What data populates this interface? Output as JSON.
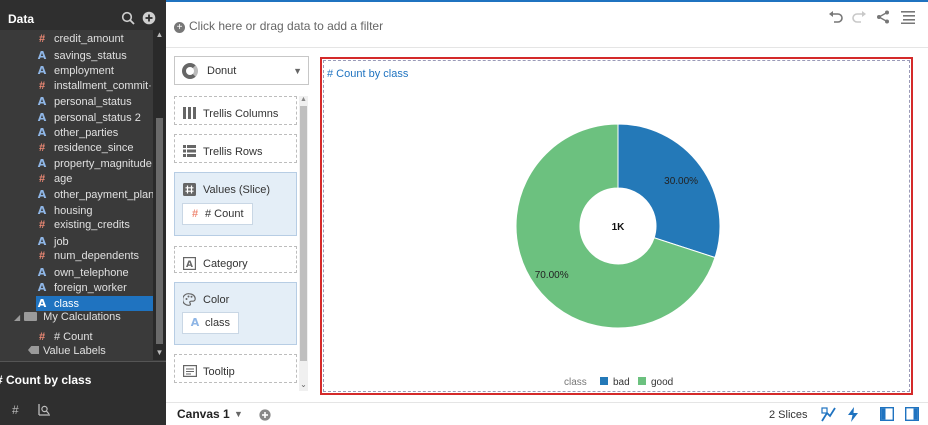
{
  "data_panel": {
    "title": "Data",
    "items": [
      {
        "label": "credit_amount",
        "type": "number"
      },
      {
        "label": "savings_status",
        "type": "attribute"
      },
      {
        "label": "employment",
        "type": "attribute"
      },
      {
        "label": "installment_commit···",
        "type": "number"
      },
      {
        "label": "personal_status",
        "type": "attribute"
      },
      {
        "label": "personal_status 2",
        "type": "attribute"
      },
      {
        "label": "other_parties",
        "type": "attribute"
      },
      {
        "label": "residence_since",
        "type": "number"
      },
      {
        "label": "property_magnitude",
        "type": "attribute"
      },
      {
        "label": "age",
        "type": "number"
      },
      {
        "label": "other_payment_plans",
        "type": "attribute"
      },
      {
        "label": "housing",
        "type": "attribute"
      },
      {
        "label": "existing_credits",
        "type": "number"
      },
      {
        "label": "job",
        "type": "attribute"
      },
      {
        "label": "num_dependents",
        "type": "number"
      },
      {
        "label": "own_telephone",
        "type": "attribute"
      },
      {
        "label": "foreign_worker",
        "type": "attribute"
      },
      {
        "label": "class",
        "type": "attribute",
        "selected": true
      }
    ],
    "folder": "My Calculations",
    "calc_item": "# Count",
    "value_labels": "Value Labels",
    "viz_name": "# Count by class"
  },
  "filterbar": {
    "placeholder": "Click here or drag data to add a filter"
  },
  "grammar": {
    "viz_type": "Donut",
    "trellis_columns": "Trellis Columns",
    "trellis_rows": "Trellis Rows",
    "values_slice": "Values (Slice)",
    "values_chip": "# Count",
    "category": "Category",
    "color": "Color",
    "color_chip": "class",
    "tooltip": "Tooltip"
  },
  "chart_data": {
    "type": "pie",
    "title": "# Count by class",
    "center_label": "1K",
    "legend_title": "class",
    "legend_position": "bottom",
    "slices": [
      {
        "label": "bad",
        "value": 30.0,
        "display": "30.00%",
        "color": "#2479b8"
      },
      {
        "label": "good",
        "value": 70.0,
        "display": "70.00%",
        "color": "#6cc17f"
      }
    ]
  },
  "bottombar": {
    "canvas_tab": "Canvas 1",
    "slices_count": "2 Slices"
  },
  "colors": {
    "accent": "#1f73c0",
    "panel_dark": "#3a3a3a",
    "selection_border": "#d42a2a"
  }
}
